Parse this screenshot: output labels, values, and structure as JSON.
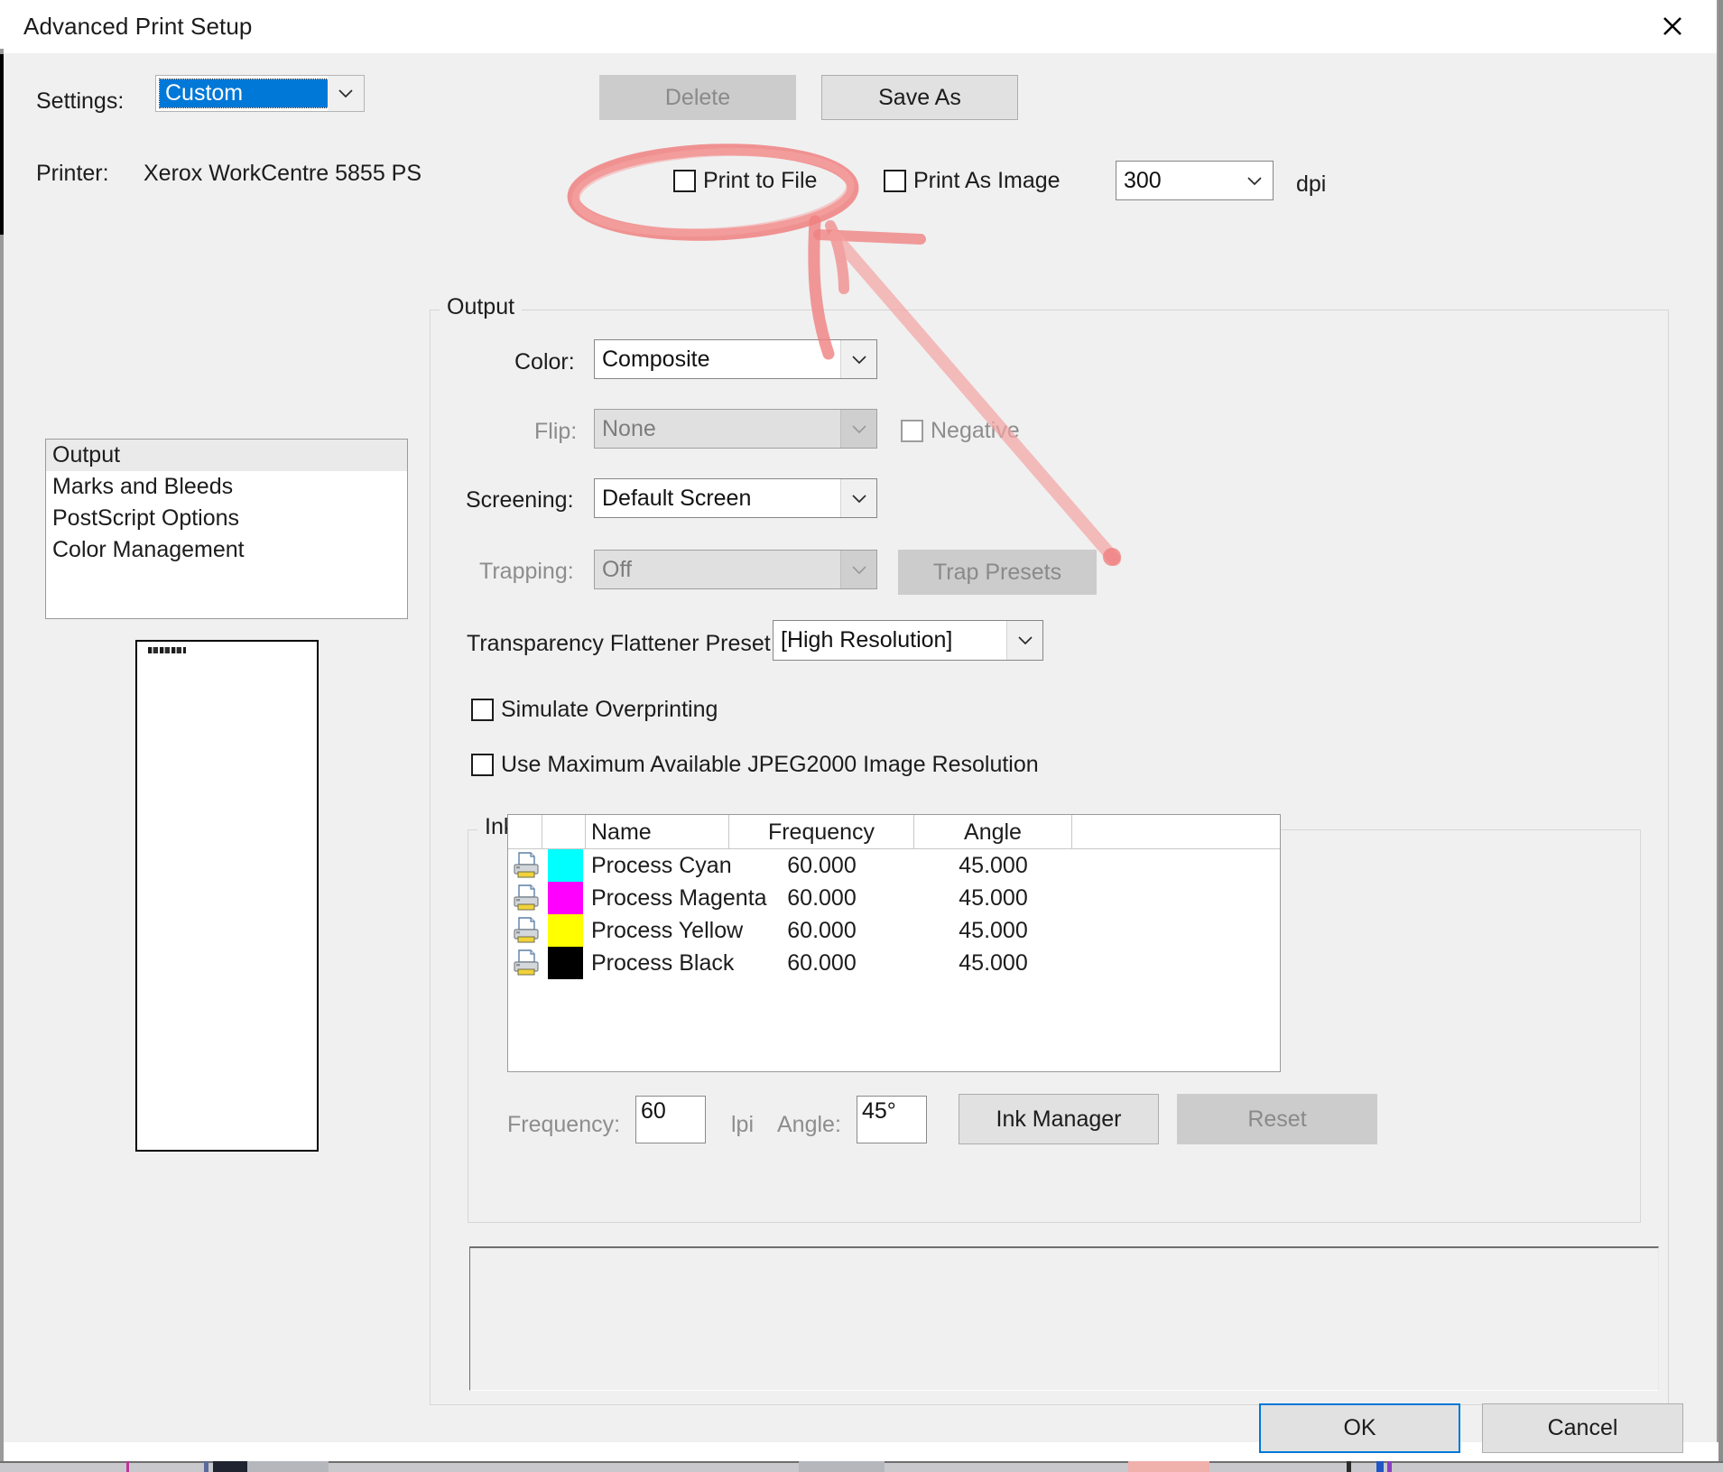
{
  "window": {
    "title": "Advanced Print Setup",
    "close_icon": "close-icon"
  },
  "settings": {
    "label": "Settings:",
    "value": "Custom",
    "delete_label": "Delete",
    "save_as_label": "Save As"
  },
  "printer": {
    "label": "Printer:",
    "name": "Xerox WorkCentre 5855 PS"
  },
  "print_options": {
    "print_to_file_label": "Print to File",
    "print_to_file_checked": false,
    "print_as_image_label": "Print As Image",
    "print_as_image_checked": false,
    "dpi_value": "300",
    "dpi_unit": "dpi"
  },
  "nav_list": {
    "items": [
      {
        "label": "Output",
        "selected": true
      },
      {
        "label": "Marks and Bleeds",
        "selected": false
      },
      {
        "label": "PostScript Options",
        "selected": false
      },
      {
        "label": "Color Management",
        "selected": false
      }
    ]
  },
  "output_group": {
    "title": "Output",
    "color_label": "Color:",
    "color_value": "Composite",
    "flip_label": "Flip:",
    "flip_value": "None",
    "negative_label": "Negative",
    "negative_checked": false,
    "screening_label": "Screening:",
    "screening_value": "Default Screen",
    "trapping_label": "Trapping:",
    "trapping_value": "Off",
    "trap_presets_label": "Trap Presets",
    "flattener_label": "Transparency Flattener Preset:",
    "flattener_value": "[High Resolution]",
    "simulate_overprinting_label": "Simulate Overprinting",
    "simulate_overprinting_checked": false,
    "jpeg2000_label": "Use Maximum Available JPEG2000 Image Resolution",
    "jpeg2000_checked": false
  },
  "ink_manager": {
    "title": "Ink Manager",
    "columns": [
      "Name",
      "Frequency",
      "Angle"
    ],
    "rows": [
      {
        "icon": "printer-icon",
        "color": "#00FFFF",
        "name": "Process Cyan",
        "frequency": "60.000",
        "angle": "45.000"
      },
      {
        "icon": "printer-icon",
        "color": "#FF00FF",
        "name": "Process Magenta",
        "frequency": "60.000",
        "angle": "45.000"
      },
      {
        "icon": "printer-icon",
        "color": "#FFFF00",
        "name": "Process Yellow",
        "frequency": "60.000",
        "angle": "45.000"
      },
      {
        "icon": "printer-icon",
        "color": "#000000",
        "name": "Process Black",
        "frequency": "60.000",
        "angle": "45.000"
      }
    ],
    "frequency_label": "Frequency:",
    "frequency_value": "60",
    "lpi_label": "lpi",
    "angle_label": "Angle:",
    "angle_value": "45°",
    "ink_manager_button": "Ink Manager",
    "reset_button": "Reset"
  },
  "footer": {
    "ok_label": "OK",
    "cancel_label": "Cancel"
  },
  "annotation": {
    "color": "#f08080",
    "shapes": [
      "ellipse-around-print-to-file",
      "arrow-pointing-down-right"
    ]
  }
}
